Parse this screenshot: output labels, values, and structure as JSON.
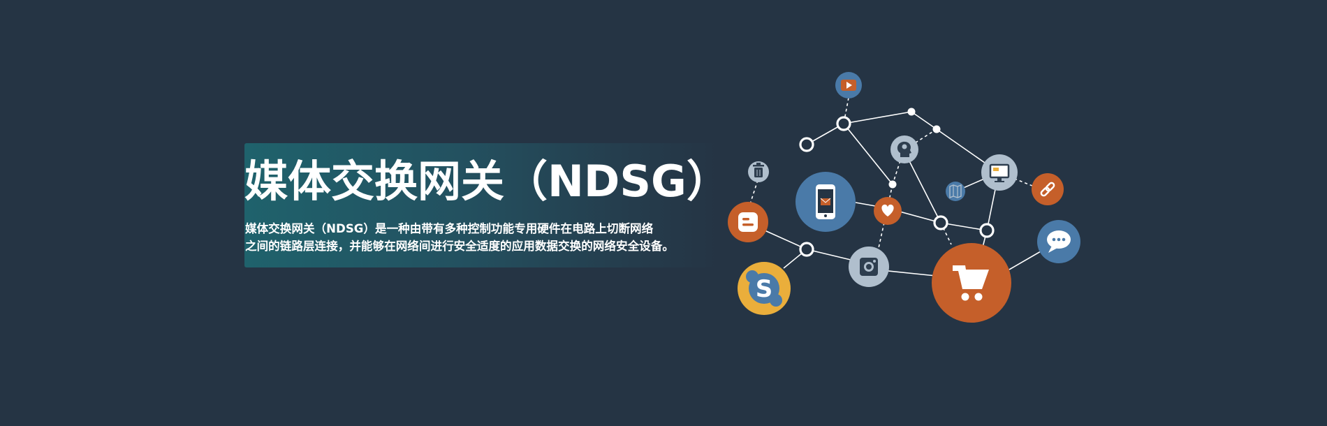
{
  "hero": {
    "title": "媒体交换网关（NDSG）",
    "description_lines": [
      "媒体交换网关（NDSG）是一种由带有多种控制功能专用硬件在电路上切断网络",
      "之间的链路层连接，并能够在网络间进行安全适度的应用数据交换的网络安全设备。"
    ]
  },
  "network": {
    "colors": {
      "background": "#253444",
      "line": "#ffffff",
      "steel_blue": "#4a7aa8",
      "orange": "#c55f2a",
      "light_gray": "#b0bfcd",
      "gold": "#eaae3b",
      "dark_icon": "#2e3e4f"
    },
    "icons": [
      "youtube-icon",
      "trash-icon",
      "blogger-icon",
      "skype-icon",
      "smartphone-mail-icon",
      "heart-icon",
      "instagram-icon",
      "brain-head-icon",
      "map-icon",
      "monitor-icon",
      "link-icon",
      "shopping-cart-icon",
      "chat-bubble-icon"
    ]
  }
}
